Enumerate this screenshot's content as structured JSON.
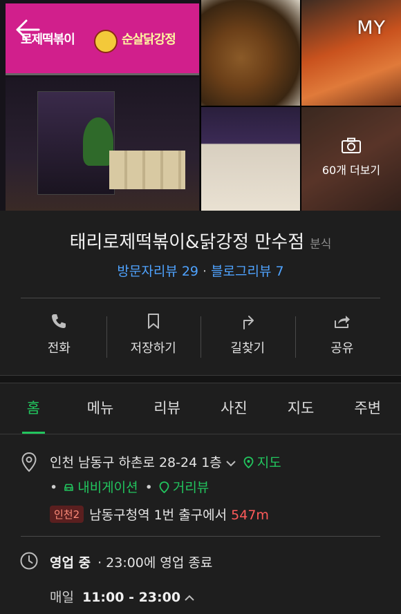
{
  "header": {
    "back_icon": "arrow-left-icon",
    "my_label": "MY"
  },
  "gallery": {
    "sign_left": "로제떡볶이",
    "sign_right": "순살닭강정",
    "more_label": "60개 더보기",
    "more_icon": "camera-icon"
  },
  "place": {
    "title": "태리로제떡볶이&닭강정 만수점",
    "category": "분식",
    "visitor_reviews": "방문자리뷰 29",
    "blog_reviews": "블로그리뷰 7"
  },
  "actions": [
    {
      "label": "전화",
      "icon": "phone-icon"
    },
    {
      "label": "저장하기",
      "icon": "bookmark-icon"
    },
    {
      "label": "길찾기",
      "icon": "directions-icon"
    },
    {
      "label": "공유",
      "icon": "share-icon"
    }
  ],
  "tabs": [
    "홈",
    "메뉴",
    "리뷰",
    "사진",
    "지도",
    "주변"
  ],
  "active_tab": "홈",
  "info": {
    "address": "인천 남동구 하촌로 28-24 1층",
    "map_link": "지도",
    "navigation_link": "내비게이션",
    "streetview_link": "거리뷰",
    "subway_line": "인천2",
    "subway_text": "남동구청역 1번 출구에서",
    "subway_distance": "547m",
    "status": "영업 중",
    "status_detail": "· 23:00에 영업 종료",
    "daily_label": "매일",
    "hours": "11:00 - 23:00"
  },
  "colors": {
    "accent_green": "#22c55e",
    "link_blue": "#4fa3ff",
    "distance_red": "#ff5a5a",
    "background": "#1e1e1e"
  }
}
